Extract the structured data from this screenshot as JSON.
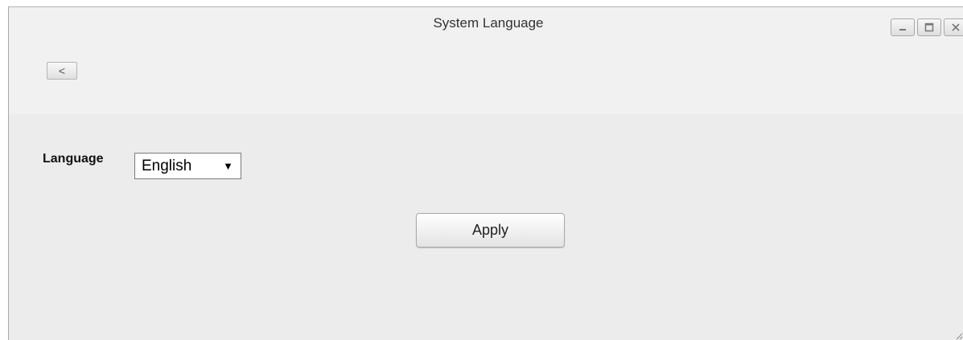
{
  "window": {
    "title": "System Language"
  },
  "controls": {
    "minimize_icon": "minimize-icon",
    "maximize_icon": "maximize-icon",
    "close_icon": "close-icon"
  },
  "toolbar": {
    "back_label": "<"
  },
  "form": {
    "language_label": "Language",
    "language_value": "English",
    "dropdown_icon": "▼"
  },
  "actions": {
    "apply_label": "Apply"
  },
  "colors": {
    "header_bg": "#f1f1f1",
    "body_bg": "#ececec"
  }
}
